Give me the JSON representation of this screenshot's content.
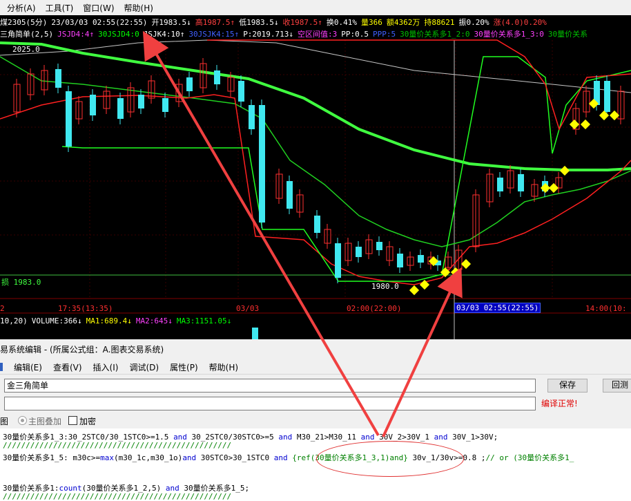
{
  "menubar": {
    "items": [
      "分析(A)",
      "工具(T)",
      "窗口(W)",
      "帮助(H)"
    ]
  },
  "chart": {
    "info_line1": [
      {
        "text": "煤2305(5分)",
        "color": "#ffffff"
      },
      {
        "text": "23/03/03 02:55(22:55)",
        "color": "#ffffff"
      },
      {
        "text": "开1983.5↓",
        "color": "#ffffff"
      },
      {
        "text": "高1987.5↑",
        "color": "#ff4040"
      },
      {
        "text": "低1983.5↓",
        "color": "#ffffff"
      },
      {
        "text": "收1987.5↑",
        "color": "#ff4040"
      },
      {
        "text": "换0.41%",
        "color": "#ffffff"
      },
      {
        "text": "量366",
        "color": "#ffff00"
      },
      {
        "text": "额4362万",
        "color": "#ffff00"
      },
      {
        "text": "持88621",
        "color": "#ffff00"
      },
      {
        "text": "振0.20%",
        "color": "#ffffff"
      },
      {
        "text": "涨(4.0)0.20%",
        "color": "#ff4040"
      }
    ],
    "info_line2": [
      {
        "text": "三角简单(2,5)",
        "color": "#ffffff"
      },
      {
        "text": "JSJD4:4↑",
        "color": "#ff40ff"
      },
      {
        "text": "30JSJD4:0",
        "color": "#00ff00"
      },
      {
        "text": "JSJK4:10↑",
        "color": "#ffffff"
      },
      {
        "text": "30JSJK4:15↑",
        "color": "#4060ff"
      },
      {
        "text": "P:2019.713↓",
        "color": "#ffffff"
      },
      {
        "text": "空区间值:3",
        "color": "#ff40ff"
      },
      {
        "text": "PP:0.5",
        "color": "#ffffff"
      },
      {
        "text": "PPP:5",
        "color": "#4060ff"
      },
      {
        "text": "30量价关系多1_2:0",
        "color": "#00c000"
      },
      {
        "text": "30量价关系多1_3:0",
        "color": "#ff40ff"
      },
      {
        "text": "30量价关系",
        "color": "#00c000"
      }
    ],
    "price_high_label": "2025.0",
    "price_low_label": "1980.0",
    "stop_label": "损 1983.0",
    "time_axis": [
      "2",
      "17:35(13:35)",
      "03/03",
      "02:00(22:00)",
      "03/03  02:55(22:55)",
      "14:00(10:"
    ],
    "volume_line": [
      {
        "text": "10,20)",
        "color": "#ffffff"
      },
      {
        "text": "VOLUME:366↓",
        "color": "#ffffff"
      },
      {
        "text": "MA1:689.4↓",
        "color": "#ffff00"
      },
      {
        "text": "MA2:645↓",
        "color": "#ff40ff"
      },
      {
        "text": "MA3:1151.05↓",
        "color": "#00ff00"
      }
    ],
    "colors": {
      "up": "#ff3030",
      "down": "#40e8f0",
      "band_green": "#00ff00",
      "bright_green": "#40ff40",
      "ma_white": "#c8c8c8"
    },
    "marker_icon": "diamond-arrow-icon"
  },
  "editor": {
    "title": "易系统编辑 - (所属公式组：A.图表交易系统)",
    "menu": [
      "编辑(E)",
      "查看(V)",
      "插入(I)",
      "调试(D)",
      "属性(P)",
      "帮助(H)"
    ],
    "name_value": "金三角简单",
    "status_text": "编译正常!",
    "save_label": "保存",
    "back_label": "回测",
    "radio_label": "主图叠加",
    "checkbox_label": "加密",
    "left_label": "图",
    "code_lines": [
      "30量价关系多1_3:30_2STC0/30_1STC0>=1.5 and 30_2STC0/30STC0>=5  and M30_21>M30_11 and 30V_2>30V_1 and 30V_1>30V;",
      "//////////////////////////////////////////////////",
      "30量价关系多1_5: m30c>=max(m30_1c,m30_1o)and  30STC0>30_1STC0 and {ref(30量价关系多1_3,1)and} 30v_1/30v>=0.8 ;// or (30量价关系多1_",
      "",
      "30量价关系多1:count(30量价关系多1_2,5) and 30量价关系多1_5;",
      "//////////////////////////////////////////////////"
    ]
  }
}
